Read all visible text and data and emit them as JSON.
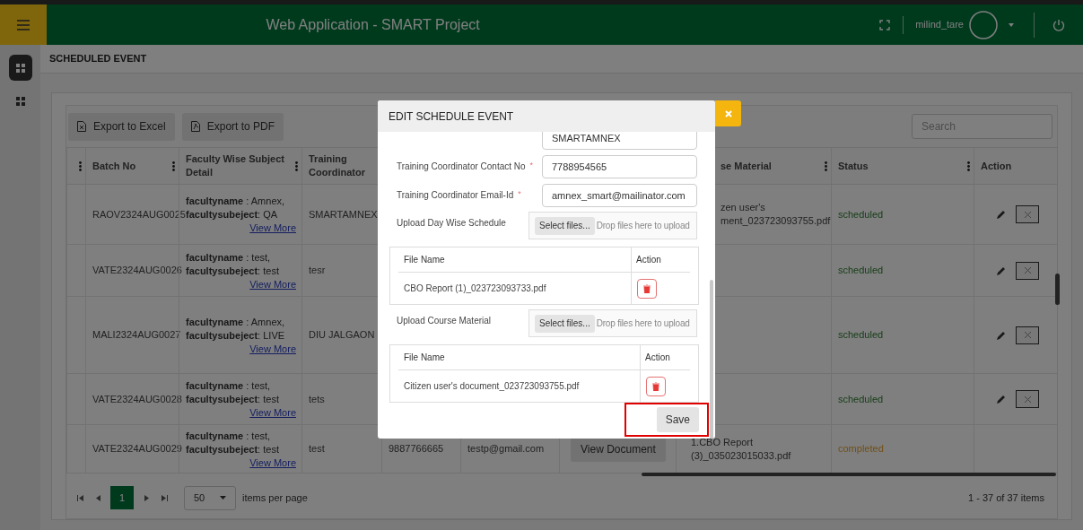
{
  "header": {
    "title": "Web Application - SMART Project",
    "user": "milind_tare"
  },
  "breadcrumb": "SCHEDULED EVENT",
  "toolbar": {
    "buttons": [
      {
        "label": "Export to Excel",
        "kind": "excel"
      },
      {
        "label": "Export to PDF",
        "kind": "pdf"
      }
    ],
    "search": {
      "placeholder": "Search"
    }
  },
  "table": {
    "columns": [
      {
        "menu": true,
        "kind": "menu"
      },
      {
        "label": "Batch No",
        "menu": true,
        "kind": "batch"
      },
      {
        "label": "Faculty Wise Subject Detail",
        "menu": true,
        "kind": "faculty"
      },
      {
        "label": "Training Coordinator",
        "menu": false,
        "kind": "coordinator"
      },
      {
        "label": "se Material",
        "menu": true,
        "kind": "material"
      },
      {
        "label": "Status",
        "menu": true,
        "kind": "status"
      },
      {
        "label": "Action",
        "menu": false,
        "kind": "action"
      }
    ],
    "rows": [
      {
        "batch": "RAOV2324AUG0025",
        "faculty": [
          "**facultyname** : Amnex,",
          "**facultysubeject**: QA"
        ],
        "link": "View More",
        "coordinator": "SMARTAMNEX",
        "material": "zen user's ment_023723093755.pdf",
        "status": "scheduled",
        "completed": false,
        "actions": true
      },
      {
        "batch": "VATE2324AUG0026",
        "faculty": [
          "**facultyname** : test,",
          "**facultysubeject**: test"
        ],
        "link": "View More",
        "coordinator": "tesr",
        "status": "scheduled",
        "completed": false,
        "actions": true
      },
      {
        "batch": "MALI2324AUG0027",
        "faculty": [
          "**facultyname** : Amnex,",
          "**facultysubeject**: LIVE"
        ],
        "link": "View More",
        "coordinator": "DIU JALGAON",
        "status": "scheduled",
        "completed": false,
        "actions": true
      },
      {
        "batch": "VATE2324AUG0028",
        "faculty": [
          "**facultyname** : test,",
          "**facultysubeject**: test"
        ],
        "link": "View More",
        "coordinator": "tets",
        "status": "scheduled",
        "completed": false,
        "actions": true
      },
      {
        "batch": "VATE2324AUG0029",
        "faculty": [
          "**facultyname** : test,",
          "**facultysubeject**: test"
        ],
        "link": "View More",
        "coordinator": "test",
        "contact": "9887766665",
        "email": "testp@gmail.com",
        "document": "View Document",
        "material": "1.CBO Report (3)_035023015033.pdf",
        "status": "completed",
        "completed": true,
        "actions": false
      }
    ]
  },
  "pager": {
    "pages": [
      {
        "label": "1",
        "selected": true
      }
    ],
    "page_size": "50",
    "page_size_label": "items per page",
    "summary": "1 - 37 of 37 items"
  },
  "modal": {
    "title": "EDIT SCHEDULE EVENT",
    "fields": [
      {
        "kind": "text",
        "value": "SMARTAMNEX"
      },
      {
        "kind": "text",
        "label": "Training Coordinator Contact No",
        "required_mark": "*",
        "value": "7788954565"
      },
      {
        "kind": "text",
        "label": "Training Coordinator Email-Id",
        "required_mark": "*",
        "value": "amnex_smart@mailinator.com"
      },
      {
        "kind": "upload",
        "label": "Upload Day Wise Schedule",
        "button": "Select files...",
        "hint": "Drop files here to upload",
        "columns": [
          "File Name",
          "Action"
        ],
        "files": [
          "CBO Report (1)_023723093733.pdf"
        ]
      },
      {
        "kind": "upload",
        "label": "Upload Course Material",
        "button": "Select files...",
        "hint": "Drop files here to upload",
        "columns": [
          "File Name",
          "Action"
        ],
        "files": [
          "Citizen user's document_023723093755.pdf"
        ]
      }
    ],
    "save": {
      "label": "Save",
      "highlighted": true
    }
  }
}
